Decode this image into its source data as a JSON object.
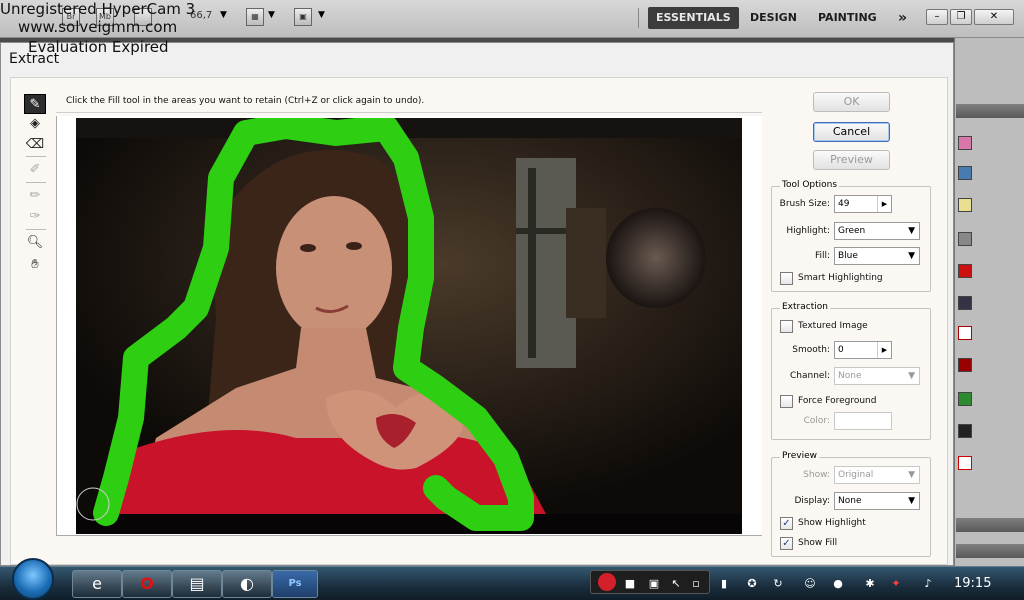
{
  "watermark": {
    "line1": "Unregistered HyperCam 3",
    "line2": "www.solveigmm.com",
    "line3": "Evaluation Expired"
  },
  "ps_topbar": {
    "zoom": "66,7",
    "workspaces": [
      "ESSENTIALS",
      "DESIGN",
      "PAINTING"
    ],
    "more": "»",
    "bridge_label": "Br",
    "minibridge_label": "Mb"
  },
  "dialog": {
    "title": "Extract",
    "instructions": "Click the Fill tool in the areas you want to retain (Ctrl+Z or click again to undo).",
    "buttons": {
      "ok": "OK",
      "cancel": "Cancel",
      "preview": "Preview"
    },
    "tool_options": {
      "title": "Tool Options",
      "brush_size_label": "Brush Size:",
      "brush_size": "49",
      "highlight_label": "Highlight:",
      "highlight": "Green",
      "fill_label": "Fill:",
      "fill": "Blue",
      "smart_highlighting_label": "Smart Highlighting",
      "smart_highlighting": false
    },
    "extraction": {
      "title": "Extraction",
      "textured_image_label": "Textured Image",
      "textured_image": false,
      "smooth_label": "Smooth:",
      "smooth": "0",
      "channel_label": "Channel:",
      "channel": "None",
      "force_foreground_label": "Force Foreground",
      "force_foreground": false,
      "color_label": "Color:"
    },
    "preview": {
      "title": "Preview",
      "show_label": "Show:",
      "show": "Original",
      "display_label": "Display:",
      "display": "None",
      "show_highlight_label": "Show Highlight",
      "show_highlight": true,
      "show_fill_label": "Show Fill",
      "show_fill": true
    },
    "tools": [
      "edge-highlighter-icon",
      "fill-bucket-icon",
      "eraser-icon",
      "eyedropper-icon",
      "cleanup-icon",
      "edge-touchup-icon",
      "zoom-icon",
      "hand-icon"
    ]
  },
  "colors": {
    "highlight_green": "#2ecf12",
    "dialog_bg": "#f0f0f0",
    "active_workspace": "#3c3c3c"
  },
  "taskbar": {
    "apps": [
      "ie-icon",
      "opera-icon",
      "network-icon",
      "hypercam-icon",
      "photoshop-icon"
    ],
    "photoshop_label": "Ps",
    "clock": "19:15"
  }
}
